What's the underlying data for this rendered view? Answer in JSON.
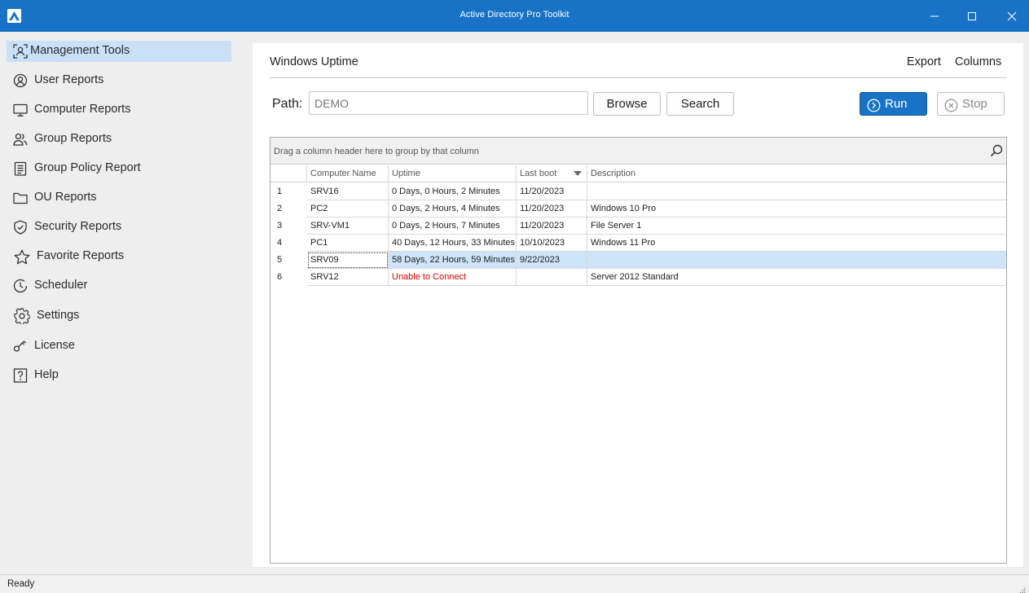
{
  "window": {
    "title": "Active Directory Pro Toolkit"
  },
  "sidebar": {
    "items": [
      {
        "label": "Management Tools",
        "icon": "management-tools-icon",
        "active": true
      },
      {
        "label": "User Reports",
        "icon": "user-icon"
      },
      {
        "label": "Computer Reports",
        "icon": "monitor-icon"
      },
      {
        "label": "Group Reports",
        "icon": "group-icon"
      },
      {
        "label": "Group Policy Report",
        "icon": "policy-icon"
      },
      {
        "label": "OU Reports",
        "icon": "folder-icon"
      },
      {
        "label": "Security Reports",
        "icon": "shield-icon"
      },
      {
        "label": "Favorite Reports",
        "icon": "star-icon"
      },
      {
        "label": "Scheduler",
        "icon": "clock-icon"
      },
      {
        "label": "Settings",
        "icon": "gear-icon"
      },
      {
        "label": "License",
        "icon": "key-icon"
      },
      {
        "label": "Help",
        "icon": "help-icon"
      }
    ]
  },
  "main": {
    "title": "Windows Uptime",
    "export_label": "Export",
    "columns_label": "Columns",
    "path_label": "Path:",
    "path_placeholder": "DEMO",
    "browse_label": "Browse",
    "search_label": "Search",
    "run_label": "Run",
    "stop_label": "Stop"
  },
  "grid": {
    "group_hint": "Drag a column header here to group by that column",
    "columns": [
      "Computer Name",
      "Uptime",
      "Last boot",
      "Description"
    ],
    "sorted_column": "Last boot",
    "rows": [
      {
        "num": "1",
        "computer": "SRV16",
        "uptime": "0 Days, 0 Hours, 2 Minutes",
        "last_boot": "11/20/2023",
        "description": ""
      },
      {
        "num": "2",
        "computer": "PC2",
        "uptime": "0 Days, 2 Hours, 4 Minutes",
        "last_boot": "11/20/2023",
        "description": "Windows 10 Pro"
      },
      {
        "num": "3",
        "computer": "SRV-VM1",
        "uptime": "0 Days, 2 Hours, 7 Minutes",
        "last_boot": "11/20/2023",
        "description": "File Server 1"
      },
      {
        "num": "4",
        "computer": "PC1",
        "uptime": "40 Days, 12 Hours, 33 Minutes",
        "last_boot": "10/10/2023",
        "description": "Windows 11 Pro"
      },
      {
        "num": "5",
        "computer": "SRV09",
        "uptime": "58 Days, 22 Hours, 59 Minutes",
        "last_boot": "9/22/2023",
        "description": "",
        "selected": true
      },
      {
        "num": "6",
        "computer": "SRV12",
        "uptime": "Unable to Connect",
        "last_boot": "",
        "description": "Server 2012 Standard",
        "error": true
      }
    ]
  },
  "status": {
    "text": "Ready"
  },
  "colors": {
    "accent": "#1873c6",
    "selection": "#cde4f9",
    "nav_active": "#c9e0f7",
    "error_text": "#d10000"
  }
}
